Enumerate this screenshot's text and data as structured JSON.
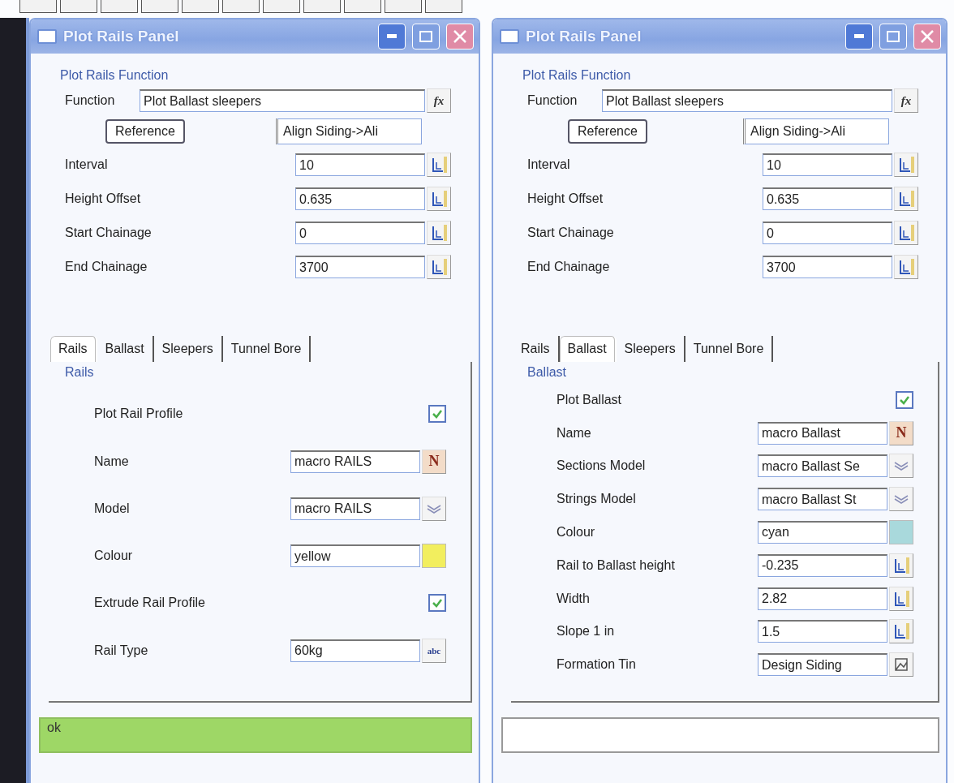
{
  "panels": [
    {
      "title": "Plot Rails Panel",
      "function_group": {
        "heading": "Plot Rails Function",
        "function": {
          "label": "Function",
          "value": "Plot Ballast sleepers",
          "button_text": "fx"
        },
        "reference": {
          "button": "Reference",
          "value": "Align Siding->Ali"
        },
        "params": [
          {
            "label": "Interval",
            "value": "10"
          },
          {
            "label": "Height Offset",
            "value": "0.635"
          },
          {
            "label": "Start Chainage",
            "value": "0"
          },
          {
            "label": "End Chainage",
            "value": "3700"
          }
        ]
      },
      "tabs": [
        {
          "label": "Rails",
          "selected": true
        },
        {
          "label": "Ballast",
          "selected": false
        },
        {
          "label": "Sleepers",
          "selected": false
        },
        {
          "label": "Tunnel Bore",
          "selected": false
        }
      ],
      "tab_page": {
        "heading": "Rails",
        "rows": [
          {
            "kind": "checkbox",
            "label": "Plot Rail Profile",
            "checked": true
          },
          {
            "kind": "name_field",
            "label": "Name",
            "value": "macro RAILS",
            "picker_text": "N"
          },
          {
            "kind": "model_field",
            "label": "Model",
            "value": "macro RAILS"
          },
          {
            "kind": "colour_field",
            "label": "Colour",
            "value": "yellow",
            "color": "#f2ee5e"
          },
          {
            "kind": "checkbox",
            "label": "Extrude Rail Profile",
            "checked": true
          },
          {
            "kind": "text_field",
            "label": "Rail Type",
            "value": "60kg",
            "picker_text": "abc"
          }
        ]
      },
      "status": {
        "text": "ok",
        "highlighted": true
      }
    },
    {
      "title": "Plot Rails Panel",
      "function_group": {
        "heading": "Plot Rails Function",
        "function": {
          "label": "Function",
          "value": "Plot Ballast sleepers",
          "button_text": "fx"
        },
        "reference": {
          "button": "Reference",
          "value": "Align Siding->Ali"
        },
        "params": [
          {
            "label": "Interval",
            "value": "10"
          },
          {
            "label": "Height Offset",
            "value": "0.635"
          },
          {
            "label": "Start Chainage",
            "value": "0"
          },
          {
            "label": "End Chainage",
            "value": "3700"
          }
        ]
      },
      "tabs": [
        {
          "label": "Rails",
          "selected": false
        },
        {
          "label": "Ballast",
          "selected": true
        },
        {
          "label": "Sleepers",
          "selected": false
        },
        {
          "label": "Tunnel Bore",
          "selected": false
        }
      ],
      "tab_page": {
        "heading": "Ballast",
        "rows": [
          {
            "kind": "checkbox",
            "label": "Plot Ballast",
            "checked": true
          },
          {
            "kind": "name_field",
            "label": "Name",
            "value": "macro Ballast",
            "picker_text": "N"
          },
          {
            "kind": "model_field",
            "label": "Sections Model",
            "value": "macro Ballast Se"
          },
          {
            "kind": "model_field",
            "label": "Strings Model",
            "value": "macro Ballast St"
          },
          {
            "kind": "colour_field",
            "label": "Colour",
            "value": "cyan",
            "color": "#a9d9dc"
          },
          {
            "kind": "increment_field",
            "label": "Rail to Ballast height",
            "value": "-0.235"
          },
          {
            "kind": "increment_field",
            "label": "Width",
            "value": "2.82"
          },
          {
            "kind": "increment_field",
            "label": "Slope 1 in",
            "value": "1.5"
          },
          {
            "kind": "tin_field",
            "label": "Formation Tin",
            "value": "Design Siding"
          }
        ]
      },
      "status": {
        "highlighted": false
      }
    }
  ]
}
